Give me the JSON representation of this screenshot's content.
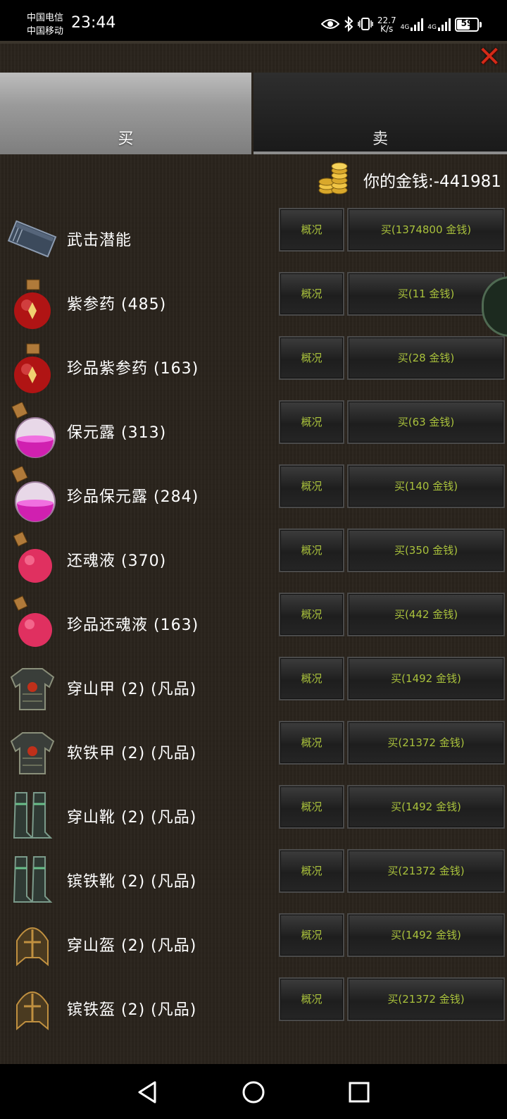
{
  "status_bar": {
    "carrier_1": "中国电信",
    "carrier_2": "中国移动",
    "time": "23:44",
    "net_speed_value": "22.7",
    "net_speed_unit": "K/s",
    "signal_1": "4G",
    "signal_2": "4G",
    "battery": "59",
    "icons": [
      "eye-icon",
      "bluetooth-icon",
      "vibrate-icon",
      "signal-icon",
      "battery-icon"
    ]
  },
  "shop": {
    "close_icon": "close-icon",
    "tabs": [
      {
        "label": "买",
        "active": true
      },
      {
        "label": "卖",
        "active": false
      }
    ],
    "money_label": "你的金钱:-441981",
    "items": [
      {
        "name": "武击潜能",
        "icon": "book-icon",
        "info_label": "概况",
        "buy_label": "买(1374800 金钱)"
      },
      {
        "name": "紫参药 (485)",
        "icon": "red-potion-icon",
        "info_label": "概况",
        "buy_label": "买(11 金钱)"
      },
      {
        "name": "珍品紫参药 (163)",
        "icon": "red-potion-icon",
        "info_label": "概况",
        "buy_label": "买(28 金钱)"
      },
      {
        "name": "保元露 (313)",
        "icon": "pink-flask-icon",
        "info_label": "概况",
        "buy_label": "买(63 金钱)"
      },
      {
        "name": "珍品保元露 (284)",
        "icon": "pink-flask-icon",
        "info_label": "概况",
        "buy_label": "买(140 金钱)"
      },
      {
        "name": "还魂液 (370)",
        "icon": "red-flask-icon",
        "info_label": "概况",
        "buy_label": "买(350 金钱)"
      },
      {
        "name": "珍品还魂液 (163)",
        "icon": "red-flask-icon",
        "info_label": "概况",
        "buy_label": "买(442 金钱)"
      },
      {
        "name": "穿山甲 (2) (凡品)",
        "icon": "armor-icon",
        "info_label": "概况",
        "buy_label": "买(1492 金钱)"
      },
      {
        "name": "软铁甲 (2) (凡品)",
        "icon": "armor-icon",
        "info_label": "概况",
        "buy_label": "买(21372 金钱)"
      },
      {
        "name": "穿山靴 (2) (凡品)",
        "icon": "boots-icon",
        "info_label": "概况",
        "buy_label": "买(1492 金钱)"
      },
      {
        "name": "镔铁靴 (2) (凡品)",
        "icon": "boots-icon",
        "info_label": "概况",
        "buy_label": "买(21372 金钱)"
      },
      {
        "name": "穿山盔 (2) (凡品)",
        "icon": "helmet-icon",
        "info_label": "概况",
        "buy_label": "买(1492 金钱)"
      },
      {
        "name": "镔铁盔 (2) (凡品)",
        "icon": "helmet-icon",
        "info_label": "概况",
        "buy_label": "买(21372 金钱)"
      }
    ]
  },
  "nav_bar": {
    "icons": [
      "back-icon",
      "home-icon",
      "recents-icon"
    ]
  }
}
